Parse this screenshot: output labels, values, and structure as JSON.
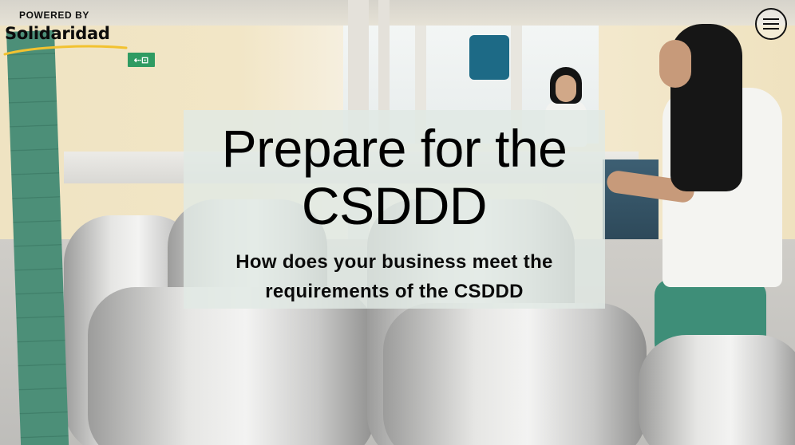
{
  "logo": {
    "powered_by": "POWERED BY",
    "brand": "Solidaridad",
    "swoosh_color": "#f2c230"
  },
  "menu": {
    "icon": "hamburger-menu-icon"
  },
  "hero": {
    "title_line1": "Prepare for the",
    "title_line2": "CSDDD",
    "subtitle_line1": "How does your business meet the",
    "subtitle_line2": "requirements of the CSDDD",
    "card_color": "#e0e9e4"
  },
  "background": {
    "exit_sign_icon": "exit-sign-icon",
    "exit_sign_text": "⇠⊡"
  }
}
